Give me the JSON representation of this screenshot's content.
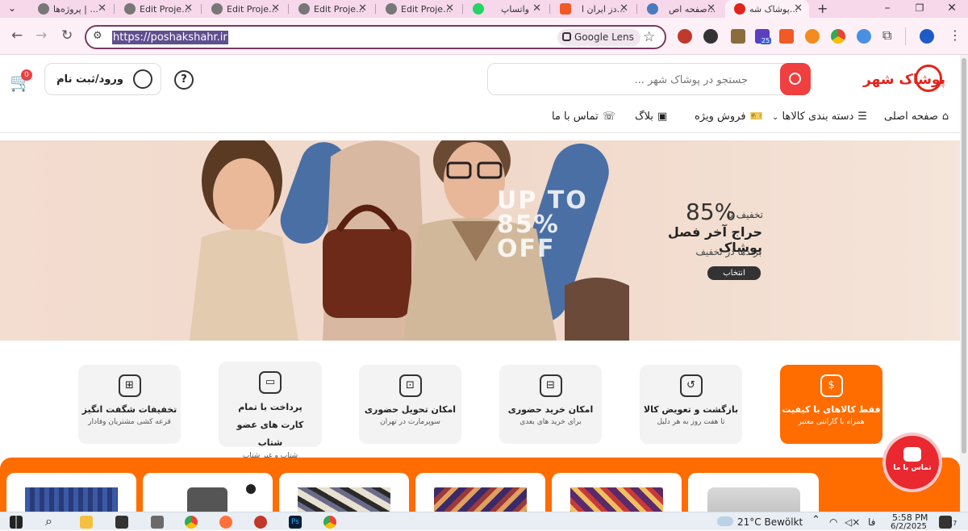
{
  "browser": {
    "tabs": [
      {
        "title": "پروژه‌ها | ...",
        "active": false
      },
      {
        "title": "Edit Proje...",
        "active": false
      },
      {
        "title": "Edit Proje...",
        "active": false
      },
      {
        "title": "Edit Proje...",
        "active": false
      },
      {
        "title": "Edit Proje...",
        "active": false
      },
      {
        "title": "واتساپ",
        "active": false
      },
      {
        "title": "دز ایران ا...",
        "active": false
      },
      {
        "title": "صفحه اص...",
        "active": false
      },
      {
        "title": "پوشاک شه...",
        "active": true
      }
    ],
    "url": "https://poshakshahr.ir",
    "lens_label": "Google Lens",
    "extension_badge": "25"
  },
  "site": {
    "logo_text": "پوشاک شهر",
    "search_placeholder": "جستجو در پوشاک شهر ...",
    "login_label": "ورود/ثبت نام",
    "help_symbol": "?",
    "cart_count": "0",
    "nav": {
      "home": "صفحه اصلی",
      "categories": "دسته بندی کالاها",
      "special_sale": "فروش ویژه",
      "blog": "بلاگ",
      "contact": "تماس با ما"
    },
    "banner": {
      "discount_prefix": "تخفیف تا",
      "discount_value": "85%",
      "title": "حراج آخر فصل پوشاک",
      "subtitle": "برندها در تخفیف",
      "button": "انتخاب",
      "image_text": "UP TO 85% OFF"
    },
    "features": [
      {
        "title": "فقط کالاهای با کیفیت",
        "subtitle": "همراه با گارانتی معتبر",
        "icon": "badge-icon",
        "primary": true
      },
      {
        "title": "بازگشت و تعویض کالا",
        "subtitle": "تا هفت روز به هر دلیل",
        "icon": "return-icon",
        "primary": false
      },
      {
        "title": "امکان خرید حضوری",
        "subtitle": "برای خرید های بعدی",
        "icon": "basket-icon",
        "primary": false
      },
      {
        "title": "امکان تحویل حضوری",
        "subtitle": "سوپرمارت در تهران",
        "icon": "car-icon",
        "primary": false
      },
      {
        "title": "پرداخت با تمام کارت های عضو شتاب",
        "subtitle": "شتاب و غیر شتاب",
        "icon": "wallet-icon",
        "primary": false
      },
      {
        "title": "تخفیفات شگفت انگیز",
        "subtitle": "قرعه کشی مشتریان وفادار",
        "icon": "gift-icon",
        "primary": false
      }
    ],
    "contact_fab": "تماس با ما"
  },
  "taskbar": {
    "weather": "21°C  Bewölkt",
    "language": "فا",
    "time": "5:58 PM",
    "date": "6/2/2025",
    "notifications": "17"
  },
  "colors": {
    "accent_orange": "#ff6c00",
    "accent_red": "#ef3f3f",
    "tab_strip": "#f6d8ea"
  }
}
